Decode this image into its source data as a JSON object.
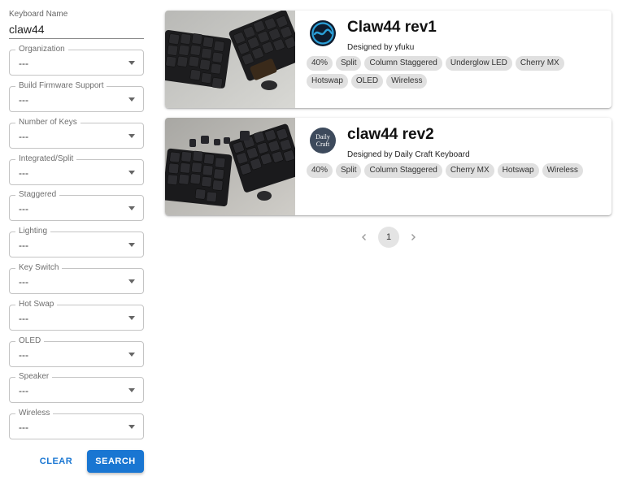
{
  "sidebar": {
    "keyboard_name": {
      "label": "Keyboard Name",
      "value": "claw44"
    },
    "filters": [
      {
        "label": "Organization",
        "value": "---"
      },
      {
        "label": "Build Firmware Support",
        "value": "---"
      },
      {
        "label": "Number of Keys",
        "value": "---"
      },
      {
        "label": "Integrated/Split",
        "value": "---"
      },
      {
        "label": "Staggered",
        "value": "---"
      },
      {
        "label": "Lighting",
        "value": "---"
      },
      {
        "label": "Key Switch",
        "value": "---"
      },
      {
        "label": "Hot Swap",
        "value": "---"
      },
      {
        "label": "OLED",
        "value": "---"
      },
      {
        "label": "Speaker",
        "value": "---"
      },
      {
        "label": "Wireless",
        "value": "---"
      }
    ],
    "clear_label": "CLEAR",
    "search_label": "SEARCH"
  },
  "results": [
    {
      "title": "Claw44 rev1",
      "designer": "Designed by yfuku",
      "logo": "swirl-logo-icon",
      "tags": [
        "40%",
        "Split",
        "Column Staggered",
        "Underglow LED",
        "Cherry MX",
        "Hotswap",
        "OLED",
        "Wireless"
      ]
    },
    {
      "title": "claw44 rev2",
      "designer": "Designed by Daily Craft Keyboard",
      "logo": "daily-craft-logo",
      "logo_text": [
        "Daily",
        "Craft"
      ],
      "tags": [
        "40%",
        "Split",
        "Column Staggered",
        "Cherry MX",
        "Hotswap",
        "Wireless"
      ]
    }
  ],
  "pagination": {
    "current_page": "1"
  },
  "colors": {
    "accent": "#1976d2",
    "chip": "#e0e0e0",
    "logo_dark": "#3d4a5c"
  }
}
